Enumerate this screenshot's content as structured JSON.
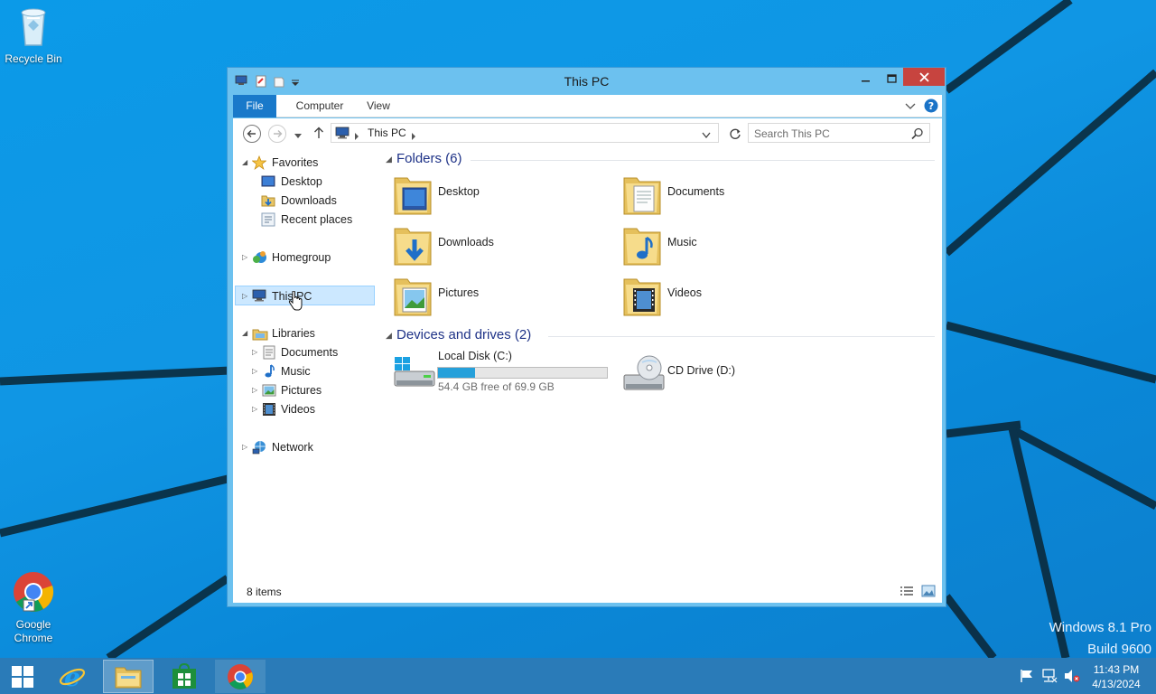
{
  "desktop": {
    "icons": [
      {
        "label": "Recycle Bin",
        "icon": "recycle-bin-icon"
      },
      {
        "label_line1": "Google",
        "label_line2": "Chrome",
        "icon": "chrome-icon"
      }
    ],
    "watermark": {
      "line1": "Windows 8.1 Pro",
      "line2": "Build 9600"
    }
  },
  "window": {
    "title": "This PC",
    "ribbon_tabs": [
      "File",
      "Computer",
      "View"
    ],
    "address": {
      "location": "This PC"
    },
    "search": {
      "placeholder": "Search This PC"
    },
    "nav": {
      "favorites": {
        "label": "Favorites",
        "items": [
          "Desktop",
          "Downloads",
          "Recent places"
        ]
      },
      "homegroup": "Homegroup",
      "this_pc": "This PC",
      "libraries": {
        "label": "Libraries",
        "items": [
          "Documents",
          "Music",
          "Pictures",
          "Videos"
        ]
      },
      "network": "Network"
    },
    "folders_header": "Folders (6)",
    "folders": [
      "Desktop",
      "Documents",
      "Downloads",
      "Music",
      "Pictures",
      "Videos"
    ],
    "devices_header": "Devices and drives (2)",
    "drives": [
      {
        "name": "Local Disk (C:)",
        "free_text": "54.4 GB free of 69.9 GB",
        "used_fraction": 0.22
      },
      {
        "name": "CD Drive (D:)"
      }
    ],
    "status": "8 items"
  },
  "taskbar": {
    "clock_time": "11:43 PM",
    "clock_date": "4/13/2024"
  },
  "colors": {
    "accent": "#1979ca",
    "selection": "#cce8ff",
    "drive_fill": "#26a0da",
    "close_button": "#c7443f"
  }
}
